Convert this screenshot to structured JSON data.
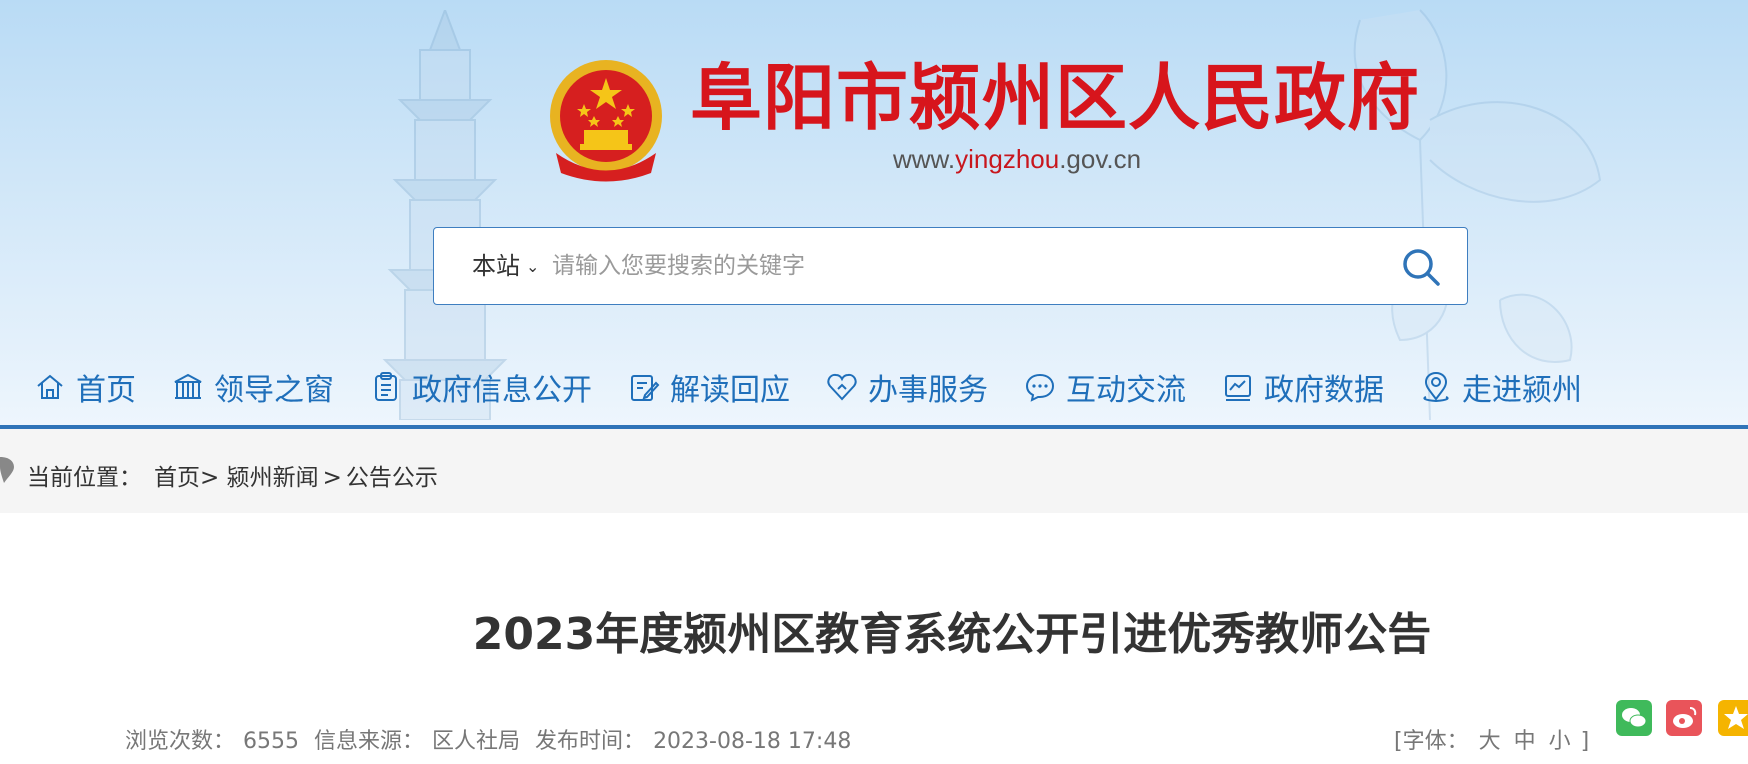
{
  "header": {
    "title": "阜阳市颍州区人民政府",
    "domain_prefix": "www.",
    "domain_highlight": "yingzhou",
    "domain_suffix": ".gov.cn"
  },
  "search": {
    "scope": "本站",
    "placeholder": "请输入您要搜索的关键字"
  },
  "nav": {
    "items": [
      {
        "label": "首页",
        "icon": "home-icon"
      },
      {
        "label": "领导之窗",
        "icon": "building-icon"
      },
      {
        "label": "政府信息公开",
        "icon": "clipboard-icon"
      },
      {
        "label": "解读回应",
        "icon": "edit-icon"
      },
      {
        "label": "办事服务",
        "icon": "heart-icon"
      },
      {
        "label": "互动交流",
        "icon": "chat-icon"
      },
      {
        "label": "政府数据",
        "icon": "chart-icon"
      },
      {
        "label": "走进颍州",
        "icon": "location-icon"
      }
    ]
  },
  "breadcrumb": {
    "label": "当前位置：",
    "items": [
      "首页",
      "颍州新闻",
      "公告公示"
    ],
    "sep1": ">",
    "sep2": ">"
  },
  "article": {
    "title": "2023年度颍州区教育系统公开引进优秀教师公告",
    "views_label": "浏览次数：",
    "views": "6555",
    "source_label": "信息来源：",
    "source": "区人社局",
    "date_label": "发布时间：",
    "date": "2023-08-18 17:48"
  },
  "fontsize": {
    "open": "[字体：",
    "large": "大",
    "medium": "中",
    "small": "小",
    "close": "]"
  },
  "colors": {
    "accent": "#1f6fba",
    "title_red": "#d7151c",
    "nav_bar": "#2f74b8"
  }
}
